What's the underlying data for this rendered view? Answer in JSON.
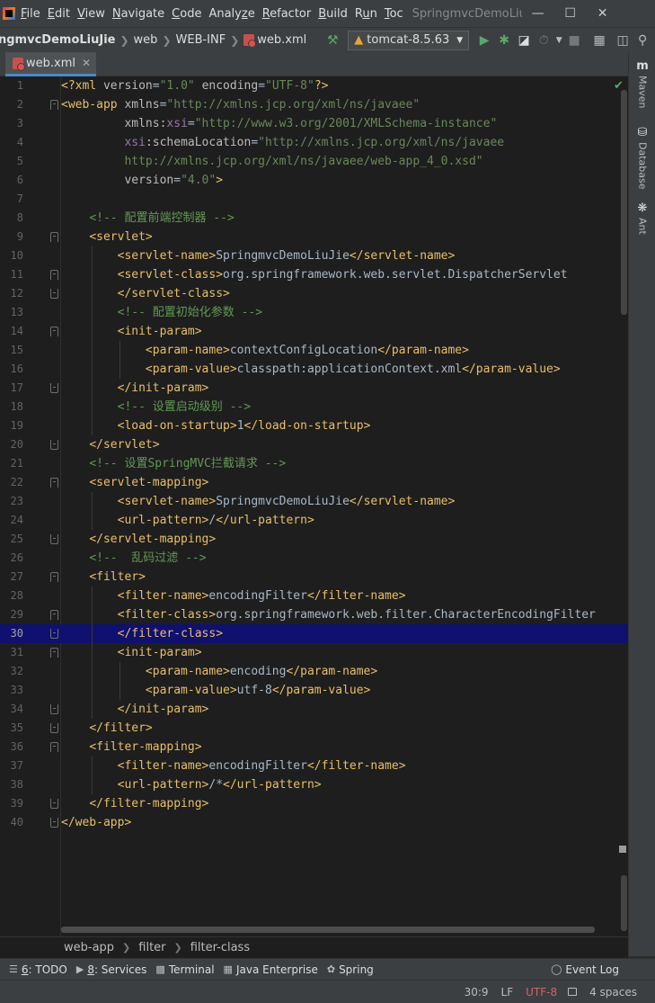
{
  "menubar": {
    "items": [
      "File",
      "Edit",
      "View",
      "Navigate",
      "Code",
      "Analyze",
      "Refactor",
      "Build",
      "Run",
      "Toc"
    ],
    "underline": [
      "F",
      "E",
      "V",
      "N",
      "C",
      "z",
      "R",
      "B",
      "u",
      "T"
    ],
    "window_title": "SpringmvcDemoLiuJi"
  },
  "navbar": {
    "crumbs": [
      "ngmvcDemoLiuJie",
      "web",
      "WEB-INF",
      "web.xml"
    ],
    "run_config": "tomcat-8.5.63"
  },
  "tab": {
    "label": "web.xml",
    "close": "✕"
  },
  "right_tools": [
    "Maven",
    "Database",
    "Ant"
  ],
  "editor": {
    "current_line": 30,
    "lines": [
      {
        "n": 1,
        "fold": "",
        "html": [
          [
            "pi",
            "<?xml "
          ],
          [
            "attr",
            "version"
          ],
          [
            "text",
            "="
          ],
          [
            "val",
            "\"1.0\""
          ],
          [
            "text",
            " "
          ],
          [
            "attr",
            "encoding"
          ],
          [
            "text",
            "="
          ],
          [
            "val",
            "\"UTF-8\""
          ],
          [
            "pi",
            "?>"
          ]
        ]
      },
      {
        "n": 2,
        "fold": "open",
        "html": [
          [
            "tag",
            "<web-app "
          ],
          [
            "attr",
            "xmlns"
          ],
          [
            "text",
            "="
          ],
          [
            "val",
            "\"http://xmlns.jcp.org/xml/ns/javaee\""
          ]
        ]
      },
      {
        "n": 3,
        "fold": "",
        "html": [
          [
            "text",
            "         "
          ],
          [
            "attr",
            "xmlns:"
          ],
          [
            "ns",
            "xsi"
          ],
          [
            "text",
            "="
          ],
          [
            "val",
            "\"http://www.w3.org/2001/XMLSchema-instance\""
          ]
        ]
      },
      {
        "n": 4,
        "fold": "",
        "html": [
          [
            "text",
            "         "
          ],
          [
            "ns",
            "xsi"
          ],
          [
            "attr",
            ":schemaLocation"
          ],
          [
            "text",
            "="
          ],
          [
            "val",
            "\"http://xmlns.jcp.org/xml/ns/javaee"
          ]
        ]
      },
      {
        "n": 5,
        "fold": "",
        "html": [
          [
            "val",
            "         http://xmlns.jcp.org/xml/ns/javaee/web-app_4_0.xsd\""
          ]
        ]
      },
      {
        "n": 6,
        "fold": "",
        "html": [
          [
            "text",
            "         "
          ],
          [
            "attr",
            "version"
          ],
          [
            "text",
            "="
          ],
          [
            "val",
            "\"4.0\""
          ],
          [
            "tag",
            ">"
          ]
        ]
      },
      {
        "n": 7,
        "fold": "",
        "html": []
      },
      {
        "n": 8,
        "fold": "",
        "html": [
          [
            "text",
            "    "
          ],
          [
            "cmt",
            "<!-- 配置前端控制器 -->"
          ]
        ]
      },
      {
        "n": 9,
        "fold": "open",
        "html": [
          [
            "text",
            "    "
          ],
          [
            "tag",
            "<servlet>"
          ]
        ]
      },
      {
        "n": 10,
        "fold": "",
        "html": [
          [
            "text",
            "        "
          ],
          [
            "tag",
            "<servlet-name>"
          ],
          [
            "text",
            "SpringmvcDemoLiuJie"
          ],
          [
            "tag",
            "</servlet-name>"
          ]
        ]
      },
      {
        "n": 11,
        "fold": "open",
        "html": [
          [
            "text",
            "        "
          ],
          [
            "tag",
            "<servlet-class>"
          ],
          [
            "text",
            "org.springframework.web.servlet.DispatcherServlet"
          ]
        ]
      },
      {
        "n": 12,
        "fold": "close",
        "html": [
          [
            "text",
            "        "
          ],
          [
            "tag",
            "</servlet-class>"
          ]
        ]
      },
      {
        "n": 13,
        "fold": "",
        "html": [
          [
            "text",
            "        "
          ],
          [
            "cmt",
            "<!-- 配置初始化参数 -->"
          ]
        ]
      },
      {
        "n": 14,
        "fold": "open",
        "html": [
          [
            "text",
            "        "
          ],
          [
            "tag",
            "<init-param>"
          ]
        ]
      },
      {
        "n": 15,
        "fold": "",
        "html": [
          [
            "text",
            "            "
          ],
          [
            "tag",
            "<param-name>"
          ],
          [
            "text",
            "contextConfigLocation"
          ],
          [
            "tag",
            "</param-name>"
          ]
        ]
      },
      {
        "n": 16,
        "fold": "",
        "html": [
          [
            "text",
            "            "
          ],
          [
            "tag",
            "<param-value>"
          ],
          [
            "text",
            "classpath:applicationContext.xml"
          ],
          [
            "tag",
            "</param-value>"
          ]
        ]
      },
      {
        "n": 17,
        "fold": "close",
        "html": [
          [
            "text",
            "        "
          ],
          [
            "tag",
            "</init-param>"
          ]
        ]
      },
      {
        "n": 18,
        "fold": "",
        "html": [
          [
            "text",
            "        "
          ],
          [
            "cmt",
            "<!-- 设置启动级别 -->"
          ]
        ]
      },
      {
        "n": 19,
        "fold": "",
        "html": [
          [
            "text",
            "        "
          ],
          [
            "tag",
            "<load-on-startup>"
          ],
          [
            "text",
            "1"
          ],
          [
            "tag",
            "</load-on-startup>"
          ]
        ]
      },
      {
        "n": 20,
        "fold": "close",
        "html": [
          [
            "text",
            "    "
          ],
          [
            "tag",
            "</servlet>"
          ]
        ]
      },
      {
        "n": 21,
        "fold": "",
        "html": [
          [
            "text",
            "    "
          ],
          [
            "cmt",
            "<!-- 设置SpringMVC拦截请求 -->"
          ]
        ]
      },
      {
        "n": 22,
        "fold": "open",
        "html": [
          [
            "text",
            "    "
          ],
          [
            "tag",
            "<servlet-mapping>"
          ]
        ]
      },
      {
        "n": 23,
        "fold": "",
        "html": [
          [
            "text",
            "        "
          ],
          [
            "tag",
            "<servlet-name>"
          ],
          [
            "text",
            "SpringmvcDemoLiuJie"
          ],
          [
            "tag",
            "</servlet-name>"
          ]
        ]
      },
      {
        "n": 24,
        "fold": "",
        "html": [
          [
            "text",
            "        "
          ],
          [
            "tag",
            "<url-pattern>"
          ],
          [
            "text",
            "/"
          ],
          [
            "tag",
            "</url-pattern>"
          ]
        ]
      },
      {
        "n": 25,
        "fold": "close",
        "html": [
          [
            "text",
            "    "
          ],
          [
            "tag",
            "</servlet-mapping>"
          ]
        ]
      },
      {
        "n": 26,
        "fold": "",
        "html": [
          [
            "text",
            "    "
          ],
          [
            "cmt",
            "<!--  乱码过滤 -->"
          ]
        ]
      },
      {
        "n": 27,
        "fold": "open",
        "html": [
          [
            "text",
            "    "
          ],
          [
            "tag",
            "<filter>"
          ]
        ]
      },
      {
        "n": 28,
        "fold": "",
        "html": [
          [
            "text",
            "        "
          ],
          [
            "tag",
            "<filter-name>"
          ],
          [
            "text",
            "encodingFilter"
          ],
          [
            "tag",
            "</filter-name>"
          ]
        ]
      },
      {
        "n": 29,
        "fold": "open",
        "html": [
          [
            "text",
            "        "
          ],
          [
            "tag",
            "<filter-class>"
          ],
          [
            "text",
            "org.springframework.web.filter.CharacterEncodingFilter"
          ]
        ]
      },
      {
        "n": 30,
        "fold": "close",
        "html": [
          [
            "text",
            "        "
          ],
          [
            "tag",
            "</filter-class>"
          ]
        ]
      },
      {
        "n": 31,
        "fold": "open",
        "html": [
          [
            "text",
            "        "
          ],
          [
            "tag",
            "<init-param>"
          ]
        ]
      },
      {
        "n": 32,
        "fold": "",
        "html": [
          [
            "text",
            "            "
          ],
          [
            "tag",
            "<param-name>"
          ],
          [
            "text",
            "encoding"
          ],
          [
            "tag",
            "</param-name>"
          ]
        ]
      },
      {
        "n": 33,
        "fold": "",
        "html": [
          [
            "text",
            "            "
          ],
          [
            "tag",
            "<param-value>"
          ],
          [
            "text",
            "utf-8"
          ],
          [
            "tag",
            "</param-value>"
          ]
        ]
      },
      {
        "n": 34,
        "fold": "close",
        "html": [
          [
            "text",
            "        "
          ],
          [
            "tag",
            "</init-param>"
          ]
        ]
      },
      {
        "n": 35,
        "fold": "close",
        "html": [
          [
            "text",
            "    "
          ],
          [
            "tag",
            "</filter>"
          ]
        ]
      },
      {
        "n": 36,
        "fold": "open",
        "html": [
          [
            "text",
            "    "
          ],
          [
            "tag",
            "<filter-mapping>"
          ]
        ]
      },
      {
        "n": 37,
        "fold": "",
        "html": [
          [
            "text",
            "        "
          ],
          [
            "tag",
            "<filter-name>"
          ],
          [
            "text",
            "encodingFilter"
          ],
          [
            "tag",
            "</filter-name>"
          ]
        ]
      },
      {
        "n": 38,
        "fold": "",
        "html": [
          [
            "text",
            "        "
          ],
          [
            "tag",
            "<url-pattern>"
          ],
          [
            "text",
            "/*"
          ],
          [
            "tag",
            "</url-pattern>"
          ]
        ]
      },
      {
        "n": 39,
        "fold": "close",
        "html": [
          [
            "text",
            "    "
          ],
          [
            "tag",
            "</filter-mapping>"
          ]
        ]
      },
      {
        "n": 40,
        "fold": "close",
        "html": [
          [
            "tag",
            "</web-app>"
          ]
        ]
      }
    ]
  },
  "breadcrumb": [
    "web-app",
    "filter",
    "filter-class"
  ],
  "tool_windows": [
    {
      "icon": "todo-icon",
      "prefix": "6",
      "label": ": TODO"
    },
    {
      "icon": "services-icon",
      "prefix": "8",
      "label": ": Services"
    },
    {
      "icon": "terminal-icon",
      "prefix": "",
      "label": "Terminal"
    },
    {
      "icon": "java-enterprise-icon",
      "prefix": "",
      "label": "Java Enterprise"
    },
    {
      "icon": "spring-icon",
      "prefix": "",
      "label": "Spring"
    }
  ],
  "event_log": "Event Log",
  "status": {
    "position": "30:9",
    "line_sep": "LF",
    "encoding": "UTF-8",
    "indent": "4 spaces"
  }
}
